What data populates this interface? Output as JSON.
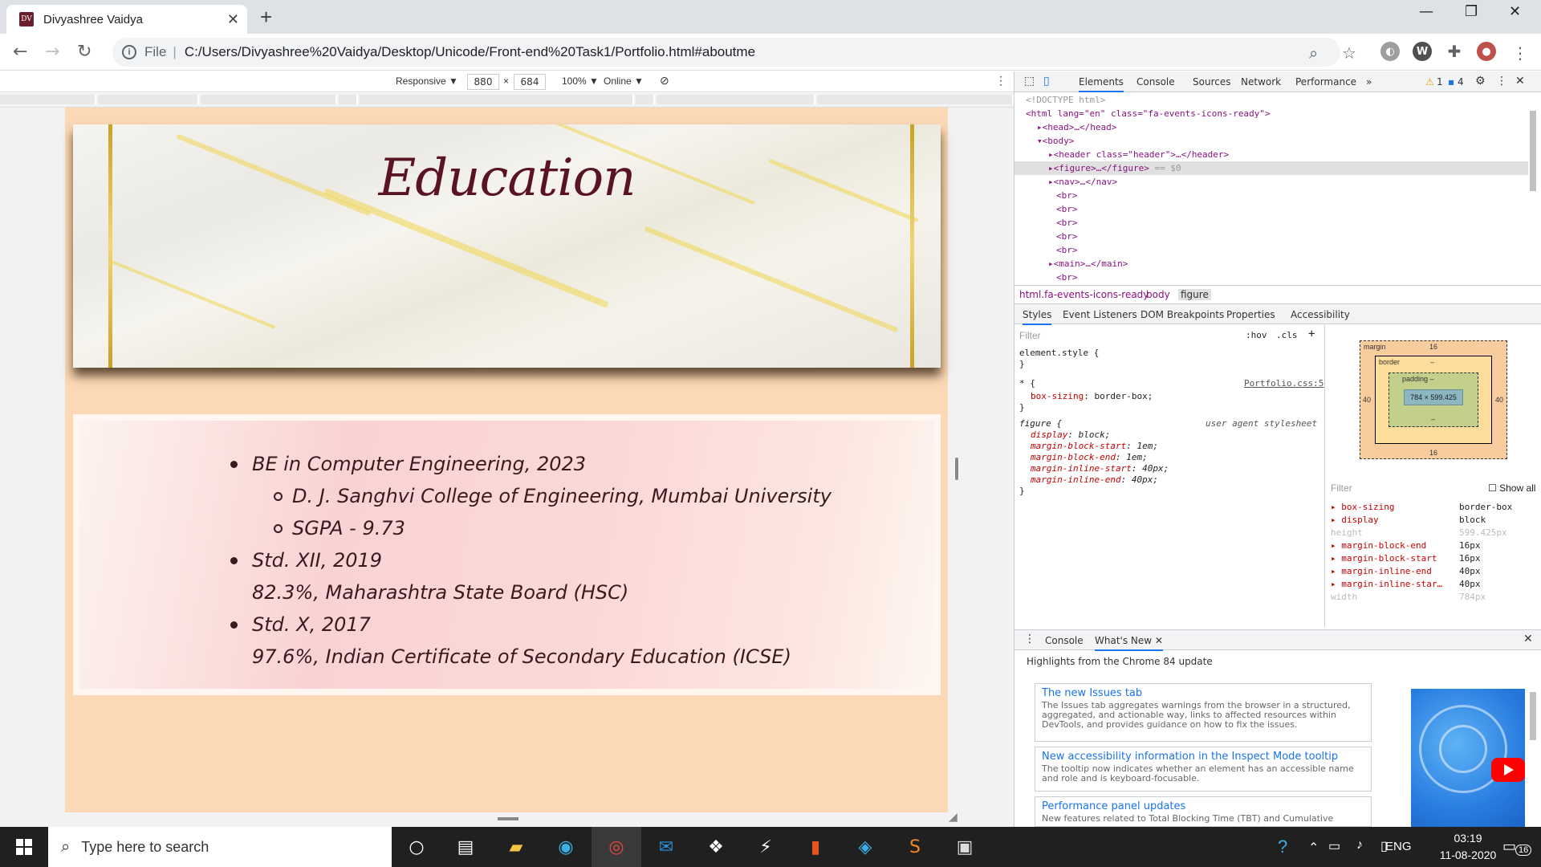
{
  "browser": {
    "tab_title": "Divyashree Vaidya",
    "favicon_text": "DV",
    "url_scheme": "File",
    "url": "C:/Users/Divyashree%20Vaidya/Desktop/Unicode/Front-end%20Task1/Portfolio.html#aboutme"
  },
  "device_toolbar": {
    "mode": "Responsive ▼",
    "width": "880",
    "times": "×",
    "height": "684",
    "zoom": "100% ▼",
    "throttle": "Online ▼"
  },
  "page": {
    "heading": "Education",
    "education": [
      {
        "type": "main",
        "text": "BE in Computer Engineering, 2023"
      },
      {
        "type": "sub",
        "text": "D. J. Sanghvi College of Engineering, Mumbai University"
      },
      {
        "type": "sub",
        "text": "SGPA - 9.73"
      },
      {
        "type": "main",
        "text": "Std. XII, 2019"
      },
      {
        "type": "plain",
        "text": "82.3%, Maharashtra State Board (HSC)"
      },
      {
        "type": "main",
        "text": "Std. X, 2017"
      },
      {
        "type": "plain",
        "text": "97.6%, Indian Certificate of Secondary Education (ICSE)"
      }
    ],
    "colors": {
      "background": "#fcd9b6",
      "heading": "#5a1322"
    }
  },
  "devtools": {
    "tabs": [
      "Elements",
      "Console",
      "Sources",
      "Network",
      "Performance",
      "»"
    ],
    "warnings": "1",
    "messages": "4",
    "dom": {
      "doctype": "<!DOCTYPE html>",
      "html_open": "<html lang=\"en\" class=\"fa-events-icons-ready\">",
      "head": "<head>…</head>",
      "body_open": "<body>",
      "header": "<header class=\"header\">…</header>",
      "figure": "<figure>…</figure>",
      "figure_marker": "== $0",
      "nav": "<nav>…</nav>",
      "br": "<br>",
      "main": "<main>…</main>"
    },
    "breadcrumbs": [
      "html.fa-events-icons-ready",
      "body",
      "figure"
    ],
    "subtabs": [
      "Styles",
      "Event Listeners",
      "DOM Breakpoints",
      "Properties",
      "Accessibility"
    ],
    "styles": {
      "filter_placeholder": "Filter",
      "hov": ":hov",
      "cls": ".cls",
      "plus": "+",
      "element_style": "element.style {",
      "close": "}",
      "universal_selector": "* {",
      "universal_source": "Portfolio.css:5",
      "box_sizing_prop": "box-sizing",
      "box_sizing_val": "border-box;",
      "figure_selector": "figure {",
      "figure_source": "user agent stylesheet",
      "figure_rules": [
        {
          "prop": "display",
          "val": "block;"
        },
        {
          "prop": "margin-block-start",
          "val": "1em;"
        },
        {
          "prop": "margin-block-end",
          "val": "1em;"
        },
        {
          "prop": "margin-inline-start",
          "val": "40px;"
        },
        {
          "prop": "margin-inline-end",
          "val": "40px;"
        }
      ]
    },
    "box_model": {
      "margin_label": "margin",
      "margin_top": "16",
      "margin_bottom": "16",
      "margin_left": "40",
      "margin_right": "40",
      "border_label": "border",
      "border_val": "–",
      "padding_label": "padding –",
      "padding_val": "–",
      "content": "784 × 599.425"
    },
    "computed": {
      "filter_placeholder": "Filter",
      "show_all": "Show all",
      "rows": [
        {
          "prop": "box-sizing",
          "val": "border-box",
          "inherited": false
        },
        {
          "prop": "display",
          "val": "block",
          "inherited": false
        },
        {
          "prop": "height",
          "val": "599.425px",
          "inherited": true
        },
        {
          "prop": "margin-block-end",
          "val": "16px",
          "inherited": false
        },
        {
          "prop": "margin-block-start",
          "val": "16px",
          "inherited": false
        },
        {
          "prop": "margin-inline-end",
          "val": "40px",
          "inherited": false
        },
        {
          "prop": "margin-inline-star…",
          "val": "40px",
          "inherited": false
        },
        {
          "prop": "width",
          "val": "784px",
          "inherited": true
        }
      ]
    },
    "drawer": {
      "tabs": [
        "Console",
        "What's New"
      ],
      "highlights": "Highlights from the Chrome 84 update",
      "cards": [
        {
          "title": "The new Issues tab",
          "desc": "The Issues tab aggregates warnings from the browser in a structured, aggregated, and actionable way, links to affected resources within DevTools, and provides guidance on how to fix the issues."
        },
        {
          "title": "New accessibility information in the Inspect Mode tooltip",
          "desc": "The tooltip now indicates whether an element has an accessible name and role and is keyboard-focusable."
        },
        {
          "title": "Performance panel updates",
          "desc": "New features related to Total Blocking Time (TBT) and Cumulative"
        }
      ]
    }
  },
  "taskbar": {
    "search_placeholder": "Type here to search",
    "language": "ENG",
    "time": "03:19",
    "date": "11-08-2020",
    "notifications": "16"
  }
}
